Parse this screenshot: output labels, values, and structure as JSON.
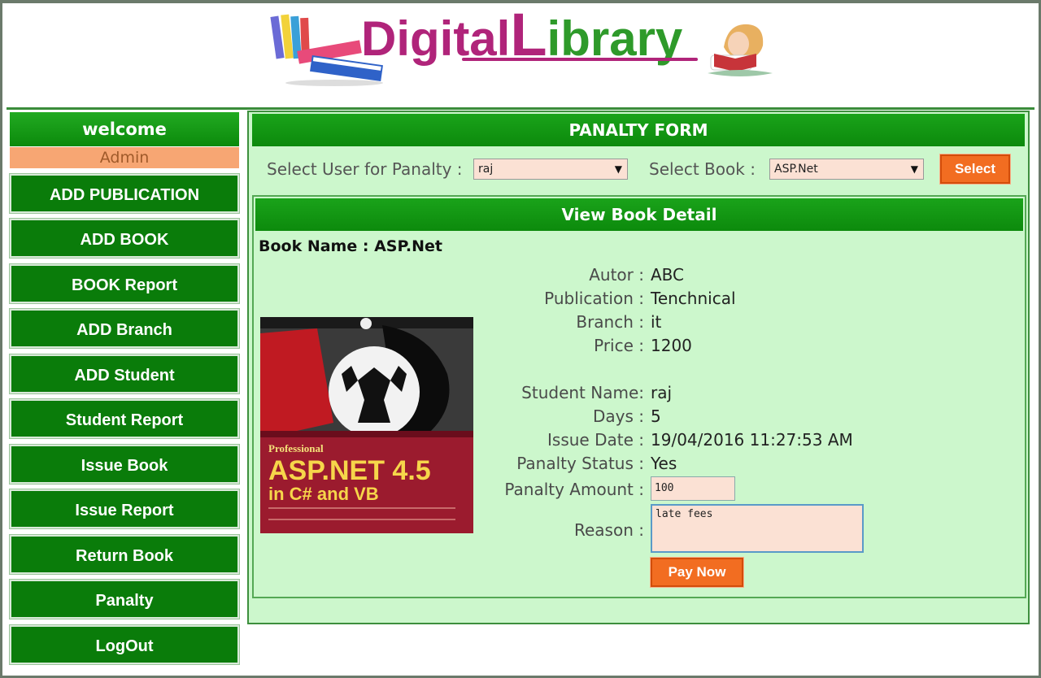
{
  "header": {
    "logo_word1": "Digital",
    "logo_word2_initial": "L",
    "logo_word2_rest": "ibrary"
  },
  "sidebar": {
    "welcome": "welcome",
    "user": "Admin",
    "items": [
      {
        "label": "ADD PUBLICATION"
      },
      {
        "label": "ADD BOOK"
      },
      {
        "label": "BOOK Report"
      },
      {
        "label": "ADD Branch"
      },
      {
        "label": "ADD Student"
      },
      {
        "label": "Student Report"
      },
      {
        "label": "Issue Book"
      },
      {
        "label": "Issue Report"
      },
      {
        "label": "Return Book"
      },
      {
        "label": "Panalty"
      },
      {
        "label": "LogOut"
      }
    ]
  },
  "form": {
    "title": "PANALTY FORM",
    "user_label": "Select User for Panalty :",
    "user_value": "raj",
    "book_label": "Select  Book :",
    "book_value": "ASP.Net",
    "select_button": "Select"
  },
  "detail": {
    "title": "View Book Detail",
    "book_name": "Book Name : ASP.Net",
    "cover": {
      "line1": "Professional",
      "line2": "ASP.NET 4.5",
      "line3": "in C# and VB"
    },
    "fields": [
      {
        "label": "Autor :",
        "value": "ABC"
      },
      {
        "label": "Publication :",
        "value": "Tenchnical"
      },
      {
        "label": "Branch :",
        "value": "it"
      },
      {
        "label": "Price :",
        "value": "1200"
      }
    ],
    "student_fields": [
      {
        "label": "Student Name:",
        "value": "raj"
      },
      {
        "label": "Days :",
        "value": "5"
      },
      {
        "label": "Issue Date :",
        "value": "19/04/2016 11:27:53 AM"
      },
      {
        "label": "Panalty Status :",
        "value": "Yes"
      }
    ],
    "amount_label": "Panalty Amount :",
    "amount_value": "100",
    "reason_label": "Reason :",
    "reason_value": "late fees",
    "pay_button": "Pay Now"
  },
  "colors": {
    "green": "#0a7c0a",
    "light_green_bg": "#ccf7cc",
    "orange": "#f26d21",
    "input_bg": "#fbe1d4",
    "logo_purple": "#b0247a",
    "logo_green": "#2e9a2a"
  }
}
